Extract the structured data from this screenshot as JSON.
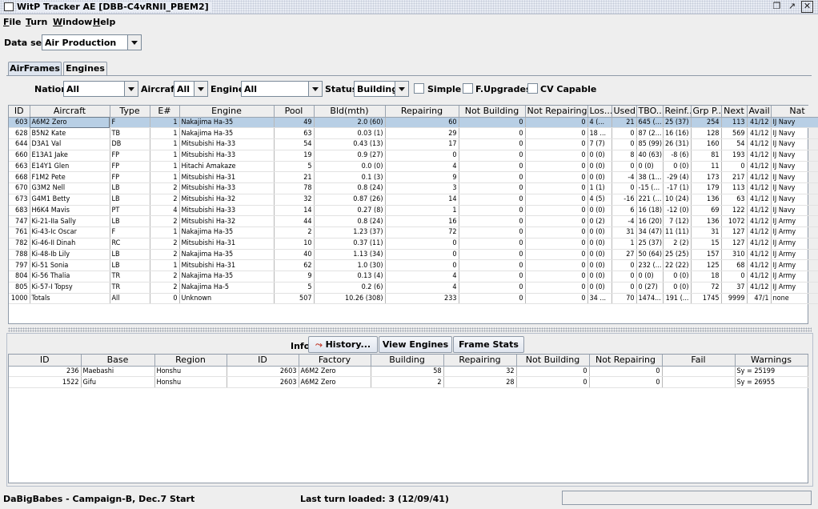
{
  "window": {
    "title": "WitP Tracker AE [DBB-C4vRNII_PBEM2]"
  },
  "menu": [
    {
      "label": "File",
      "mnemonic": "F",
      "rest": "ile"
    },
    {
      "label": "Turn",
      "mnemonic": "T",
      "rest": "urn"
    },
    {
      "label": "Window",
      "mnemonic": "W",
      "rest": "indow"
    },
    {
      "label": "Help",
      "mnemonic": "H",
      "rest": "elp"
    }
  ],
  "dataset": {
    "label": "Data set:",
    "value": "Air Production"
  },
  "tabs": [
    {
      "label": "AirFrames",
      "active": true
    },
    {
      "label": "Engines",
      "active": false
    }
  ],
  "filters": {
    "nation_label": "Nation:",
    "nation_value": "All",
    "aircraft_label": "Aircraft:",
    "aircraft_value": "All",
    "engine_label": "Engine:",
    "engine_value": "All",
    "status_label": "Status:",
    "status_value": "Building",
    "simple_label": "Simple",
    "fupgrades_label": "F.Upgrades",
    "cv_label": "CV Capable"
  },
  "airframes": {
    "columns": [
      "ID",
      "Aircraft",
      "Type",
      "E#",
      "Engine",
      "Pool",
      "Bld(mth)",
      "Repairing",
      "Not Building",
      "Not Repairing",
      "Los...",
      "Used",
      "TBO...",
      "Reinf...",
      "Grp P...",
      "Next",
      "Avail",
      "Nat"
    ],
    "rows": [
      [
        "603",
        "A6M2 Zero",
        "F",
        "1",
        "Nakajima Ha-35",
        "49",
        "2.0 (60)",
        "60",
        "0",
        "0",
        "4 (...",
        "21",
        "645 (...",
        "25 (37)",
        "254",
        "113",
        "41/12",
        "IJ Navy"
      ],
      [
        "628",
        "B5N2 Kate",
        "TB",
        "1",
        "Nakajima Ha-35",
        "63",
        "0.03 (1)",
        "29",
        "0",
        "0",
        "18 ...",
        "0",
        "87 (2...",
        "16 (16)",
        "128",
        "569",
        "41/12",
        "IJ Navy"
      ],
      [
        "644",
        "D3A1 Val",
        "DB",
        "1",
        "Mitsubishi Ha-33",
        "54",
        "0.43 (13)",
        "17",
        "0",
        "0",
        "7 (7)",
        "0",
        "85 (99)",
        "26 (31)",
        "160",
        "54",
        "41/12",
        "IJ Navy"
      ],
      [
        "660",
        "E13A1 Jake",
        "FP",
        "1",
        "Mitsubishi Ha-33",
        "19",
        "0.9 (27)",
        "0",
        "0",
        "0",
        "0 (0)",
        "8",
        "40 (63)",
        "-8 (6)",
        "81",
        "193",
        "41/12",
        "IJ Navy"
      ],
      [
        "663",
        "E14Y1 Glen",
        "FP",
        "1",
        "Hitachi Amakaze",
        "5",
        "0.0 (0)",
        "4",
        "0",
        "0",
        "0 (0)",
        "0",
        "0 (0)",
        "0 (0)",
        "11",
        "0",
        "41/12",
        "IJ Navy"
      ],
      [
        "668",
        "F1M2 Pete",
        "FP",
        "1",
        "Mitsubishi Ha-31",
        "21",
        "0.1 (3)",
        "9",
        "0",
        "0",
        "0 (0)",
        "-4",
        "38 (1...",
        "-29 (4)",
        "173",
        "217",
        "41/12",
        "IJ Navy"
      ],
      [
        "670",
        "G3M2 Nell",
        "LB",
        "2",
        "Mitsubishi Ha-33",
        "78",
        "0.8 (24)",
        "3",
        "0",
        "0",
        "1 (1)",
        "0",
        "-15 (...",
        "-17 (1)",
        "179",
        "113",
        "41/12",
        "IJ Navy"
      ],
      [
        "673",
        "G4M1 Betty",
        "LB",
        "2",
        "Mitsubishi Ha-32",
        "32",
        "0.87 (26)",
        "14",
        "0",
        "0",
        "4 (5)",
        "-16",
        "221 (...",
        "10 (24)",
        "136",
        "63",
        "41/12",
        "IJ Navy"
      ],
      [
        "683",
        "H6K4 Mavis",
        "PT",
        "4",
        "Mitsubishi Ha-33",
        "14",
        "0.27 (8)",
        "1",
        "0",
        "0",
        "0 (0)",
        "6",
        "16 (18)",
        "-12 (0)",
        "69",
        "122",
        "41/12",
        "IJ Navy"
      ],
      [
        "747",
        "Ki-21-IIa Sally",
        "LB",
        "2",
        "Mitsubishi Ha-32",
        "44",
        "0.8 (24)",
        "16",
        "0",
        "0",
        "0 (2)",
        "-4",
        "16 (20)",
        "7 (12)",
        "136",
        "1072",
        "41/12",
        "IJ Army"
      ],
      [
        "761",
        "Ki-43-Ic Oscar",
        "F",
        "1",
        "Nakajima Ha-35",
        "2",
        "1.23 (37)",
        "72",
        "0",
        "0",
        "0 (0)",
        "31",
        "34 (47)",
        "11 (11)",
        "31",
        "127",
        "41/12",
        "IJ Army"
      ],
      [
        "782",
        "Ki-46-II Dinah",
        "RC",
        "2",
        "Mitsubishi Ha-31",
        "10",
        "0.37 (11)",
        "0",
        "0",
        "0",
        "0 (0)",
        "1",
        "25 (37)",
        "2 (2)",
        "15",
        "127",
        "41/12",
        "IJ Army"
      ],
      [
        "788",
        "Ki-48-Ib Lily",
        "LB",
        "2",
        "Nakajima Ha-35",
        "40",
        "1.13 (34)",
        "0",
        "0",
        "0",
        "0 (0)",
        "27",
        "50 (64)",
        "25 (25)",
        "157",
        "310",
        "41/12",
        "IJ Army"
      ],
      [
        "797",
        "Ki-51 Sonia",
        "LB",
        "1",
        "Mitsubishi Ha-31",
        "62",
        "1.0 (30)",
        "0",
        "0",
        "0",
        "0 (0)",
        "0",
        "232 (...",
        "22 (22)",
        "125",
        "68",
        "41/12",
        "IJ Army"
      ],
      [
        "804",
        "Ki-56 Thalia",
        "TR",
        "2",
        "Nakajima Ha-35",
        "9",
        "0.13 (4)",
        "4",
        "0",
        "0",
        "0 (0)",
        "0",
        "0 (0)",
        "0 (0)",
        "18",
        "0",
        "41/12",
        "IJ Army"
      ],
      [
        "805",
        "Ki-57-I Topsy",
        "TR",
        "2",
        "Nakajima Ha-5",
        "5",
        "0.2 (6)",
        "4",
        "0",
        "0",
        "0 (0)",
        "0",
        "0 (27)",
        "0 (0)",
        "72",
        "37",
        "41/12",
        "IJ Army"
      ],
      [
        "1000",
        "Totals",
        "All",
        "0",
        "Unknown",
        "507",
        "10.26 (308)",
        "233",
        "0",
        "0",
        "34 ...",
        "70",
        "1474...",
        "191 (...",
        "1745",
        "9999",
        "47/1",
        "none"
      ]
    ]
  },
  "info": {
    "label": "Info:",
    "history_button": "History...",
    "view_engines_button": "View Engines",
    "frame_stats_button": "Frame Stats",
    "columns": [
      "ID",
      "Base",
      "Region",
      "ID",
      "Factory",
      "Building",
      "Repairing",
      "Not Building",
      "Not Repairing",
      "Fail",
      "Warnings"
    ],
    "rows": [
      [
        "236",
        "Maebashi",
        "Honshu",
        "2603",
        "A6M2 Zero",
        "58",
        "32",
        "0",
        "0",
        "",
        "Sy = 25199"
      ],
      [
        "1522",
        "Gifu",
        "Honshu",
        "2603",
        "A6M2 Zero",
        "2",
        "28",
        "0",
        "0",
        "",
        "Sy = 26955"
      ]
    ]
  },
  "status": {
    "left": "DaBigBabes - Campaign-B, Dec.7 Start",
    "middle": "Last turn loaded: 3 (12/09/41)"
  }
}
